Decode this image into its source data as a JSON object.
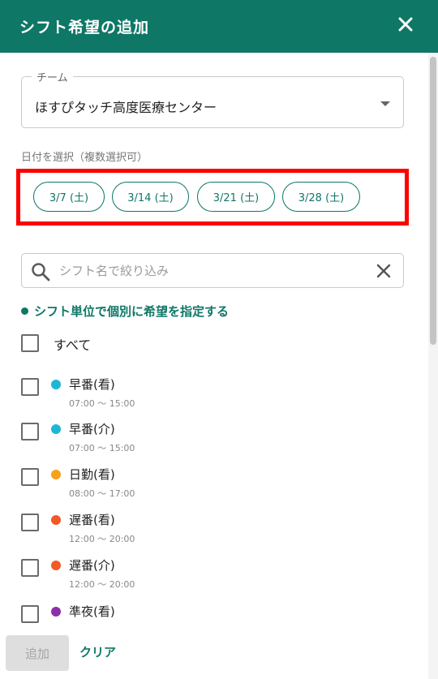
{
  "header": {
    "title": "シフト希望の追加",
    "close_icon": "close-icon"
  },
  "team": {
    "label": "チーム",
    "value": "ほすぴタッチ高度医療センター"
  },
  "date_select": {
    "label": "日付を選択（複数選択可）",
    "chips": [
      "3/7 (土)",
      "3/14 (土)",
      "3/21 (土)",
      "3/28 (土)"
    ]
  },
  "search": {
    "placeholder": "シフト名で絞り込み",
    "value": ""
  },
  "per_shift_label": "シフト単位で個別に希望を指定する",
  "all_label": "すべて",
  "shifts": [
    {
      "name": "早番(看)",
      "time": "07:00 ～ 15:00",
      "color": "#1eb6d6"
    },
    {
      "name": "早番(介)",
      "time": "07:00 ～ 15:00",
      "color": "#1eb6d6"
    },
    {
      "name": "日勤(看)",
      "time": "08:00 ～ 17:00",
      "color": "#f7a11b"
    },
    {
      "name": "遅番(看)",
      "time": "12:00 ～ 20:00",
      "color": "#f15a24"
    },
    {
      "name": "遅番(介)",
      "time": "12:00 ～ 20:00",
      "color": "#f15a24"
    },
    {
      "name": "準夜(看)",
      "time": "",
      "color": "#8e2fa8"
    }
  ],
  "footer": {
    "add_label": "追加",
    "clear_label": "クリア"
  },
  "colors": {
    "primary": "#0e7766",
    "highlight": "#ff0000"
  }
}
